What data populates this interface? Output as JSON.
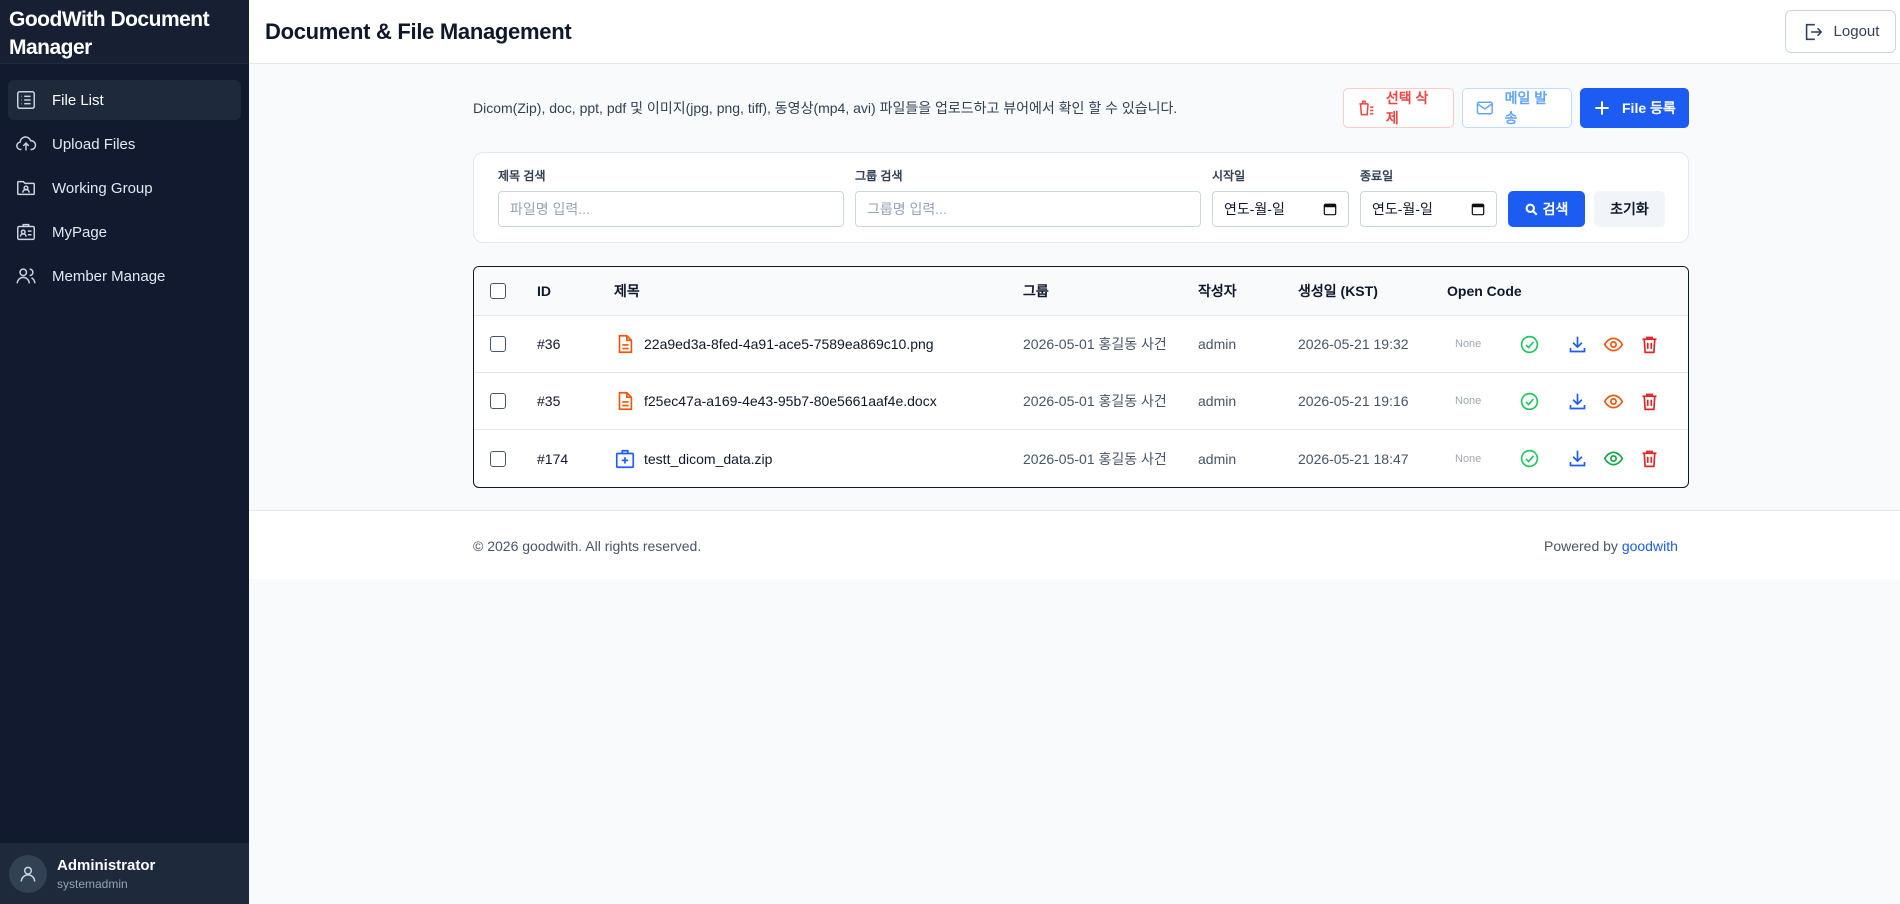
{
  "sidebar": {
    "brand": "GoodWith Document Manager",
    "items": [
      {
        "label": "File List",
        "icon": "list-icon",
        "active": true
      },
      {
        "label": "Upload Files",
        "icon": "cloud-upload-icon",
        "active": false
      },
      {
        "label": "Working Group",
        "icon": "folder-user-icon",
        "active": false
      },
      {
        "label": "MyPage",
        "icon": "id-card-icon",
        "active": false
      },
      {
        "label": "Member Manage",
        "icon": "users-icon",
        "active": false
      }
    ],
    "user": {
      "name": "Administrator",
      "role": "systemadmin"
    }
  },
  "header": {
    "title": "Document & File Management",
    "logout_label": "Logout"
  },
  "main": {
    "description": "Dicom(Zip), doc, ppt, pdf 및 이미지(jpg, png, tiff), 동영상(mp4, avi) 파일들을 업로드하고 뷰어에서 확인 할 수 있습니다.",
    "actions": {
      "delete_selected": "선택 삭제",
      "send_mail": "메일 발송",
      "register_file": "File 등록"
    },
    "search": {
      "title_label": "제목 검색",
      "title_placeholder": "파일명 입력...",
      "group_label": "그룹 검색",
      "group_placeholder": "그룹명 입력...",
      "start_label": "시작일",
      "start_value": "연도-월-일",
      "end_label": "종료일",
      "end_value": "연도-월-일",
      "search_button": "검색",
      "reset_button": "초기화"
    },
    "table": {
      "headers": {
        "id": "ID",
        "title": "제목",
        "group": "그룹",
        "author": "작성자",
        "created": "생성일 (KST)",
        "open_code": "Open Code"
      },
      "rows": [
        {
          "id": "#36",
          "title": "22a9ed3a-8fed-4a91-ace5-7589ea869c10.png",
          "file_icon": "document-icon",
          "group": "2026-05-01 홍길동 사건",
          "author": "admin",
          "created": "2026-05-21 19:32",
          "open_code": "None",
          "view_color": "#ea580c"
        },
        {
          "id": "#35",
          "title": "f25ec47a-a169-4e43-95b7-80e5661aaf4e.docx",
          "file_icon": "document-icon",
          "group": "2026-05-01 홍길동 사건",
          "author": "admin",
          "created": "2026-05-21 19:16",
          "open_code": "None",
          "view_color": "#ea580c"
        },
        {
          "id": "#174",
          "title": "testt_dicom_data.zip",
          "file_icon": "medical-case-icon",
          "group": "2026-05-01 홍길동 사건",
          "author": "admin",
          "created": "2026-05-21 18:47",
          "open_code": "None",
          "view_color": "#16a34a"
        }
      ]
    }
  },
  "footer": {
    "copyright": "© 2026 goodwith. All rights reserved.",
    "powered_prefix": "Powered by ",
    "powered_brand": "goodwith"
  },
  "colors": {
    "sidebar_bg": "#111a2e",
    "primary": "#1d5cf2",
    "danger": "#ef4444",
    "success": "#22c55e",
    "file_orange": "#ea580c"
  }
}
